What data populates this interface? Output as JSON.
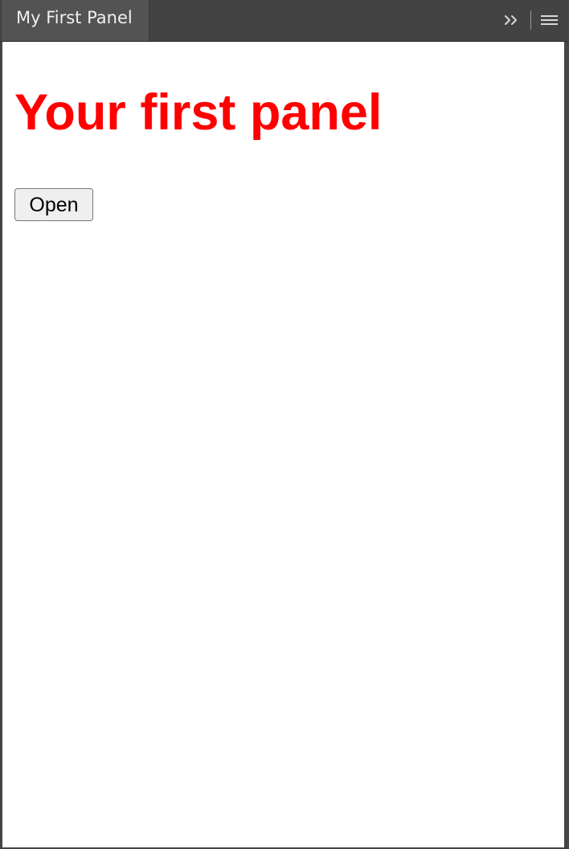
{
  "panel": {
    "tab_title": "My First Panel",
    "controls": {
      "expand_icon": "double-chevron-right-icon",
      "menu_icon": "hamburger-menu-icon"
    }
  },
  "content": {
    "title": "Your first panel",
    "open_button_label": "Open"
  },
  "colors": {
    "header_background": "#434343",
    "tab_background": "#535353",
    "body_background": "#ffffff",
    "title_color": "#ff0000",
    "button_background": "#efefef",
    "button_border": "#777777"
  }
}
